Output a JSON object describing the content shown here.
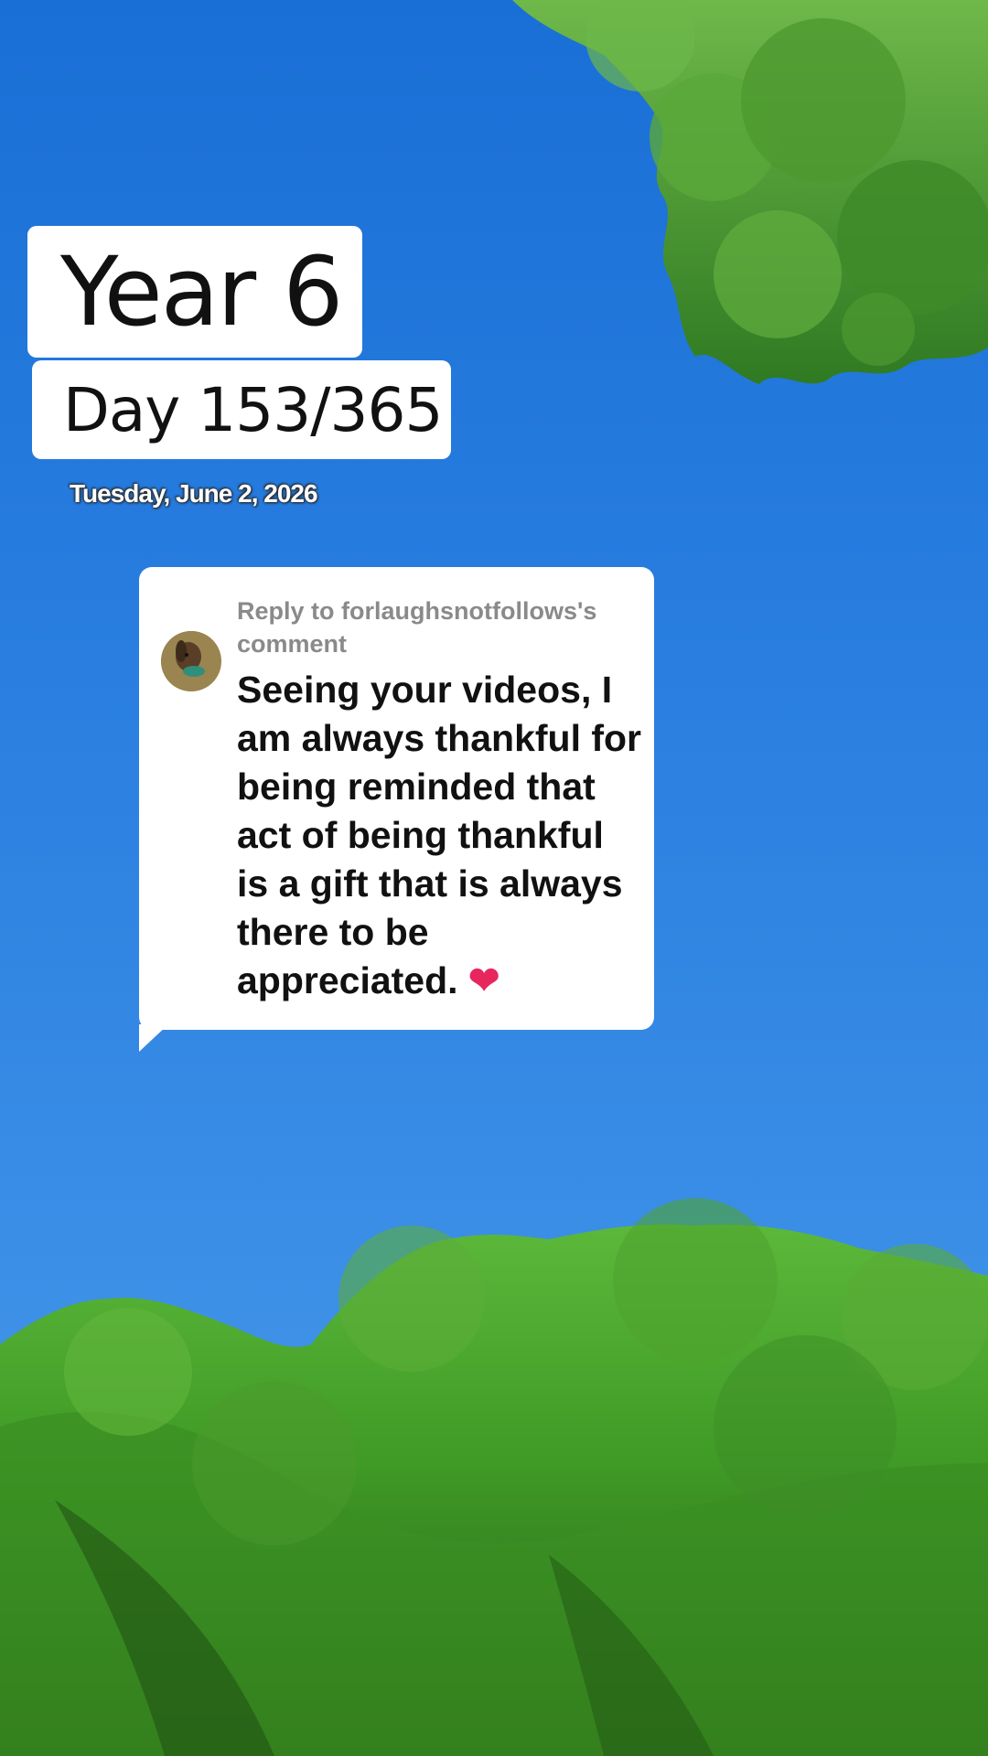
{
  "overlay": {
    "year_label": "Year 6",
    "day_label": "Day 153/365",
    "date_label": "Tuesday, June 2, 2026"
  },
  "reply": {
    "header": "Reply to forlaughsnotfollows's comment",
    "body": "Seeing your videos, I am always thankful for being reminded that act of being thankful is a gift that is always there to be appreciated.",
    "emoji": "❤",
    "avatar_icon": "dog-avatar-icon"
  },
  "colors": {
    "sky": "#2a7fe0",
    "foliage": "#3f9a2a",
    "heart": "#e8265e"
  }
}
